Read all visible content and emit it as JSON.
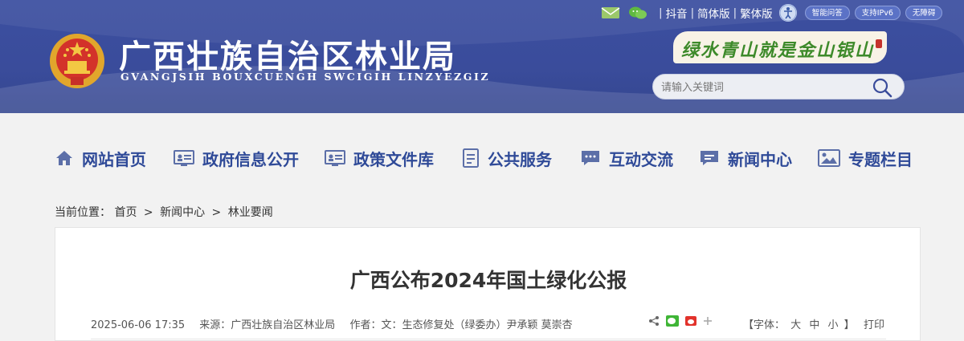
{
  "header": {
    "title": "广西壮族自治区林业局",
    "subtitle": "GVANGJSIH BOUXCUENGH SWCIGIH LINZYEZGIZ",
    "toplinks": [
      "抖音",
      "简体版",
      "繁体版"
    ],
    "pills": [
      "智能问答",
      "支持IPv6",
      "无障碍"
    ],
    "slogan": "绿水青山就是金山银山",
    "search_placeholder": "请输入关键词"
  },
  "nav": {
    "items": [
      {
        "label": "网站首页",
        "icon": "home-icon"
      },
      {
        "label": "政府信息公开",
        "icon": "info-card-icon"
      },
      {
        "label": "政策文件库",
        "icon": "document-library-icon"
      },
      {
        "label": "公共服务",
        "icon": "service-doc-icon"
      },
      {
        "label": "互动交流",
        "icon": "chat-icon"
      },
      {
        "label": "新闻中心",
        "icon": "news-chat-icon"
      },
      {
        "label": "专题栏目",
        "icon": "picture-icon"
      }
    ]
  },
  "breadcrumb": {
    "prefix": "当前位置：",
    "items": [
      "首页",
      "新闻中心",
      "林业要闻"
    ],
    "separator": ">"
  },
  "article": {
    "title": "广西公布2024年国土绿化公报",
    "date": "2025-06-06 17:35",
    "source": "来源：广西壮族自治区林业局",
    "author": "作者：文：生态修复处（绿委办）尹承颖 莫崇杏",
    "font_label_open": "【字体：",
    "font_sizes": [
      "大",
      "中",
      "小"
    ],
    "font_label_close": "】",
    "print_label": "打印"
  },
  "colors": {
    "header_bg": "#3a4c9b",
    "nav_text": "#2f4a98",
    "page_bg": "#f2f2f2"
  }
}
